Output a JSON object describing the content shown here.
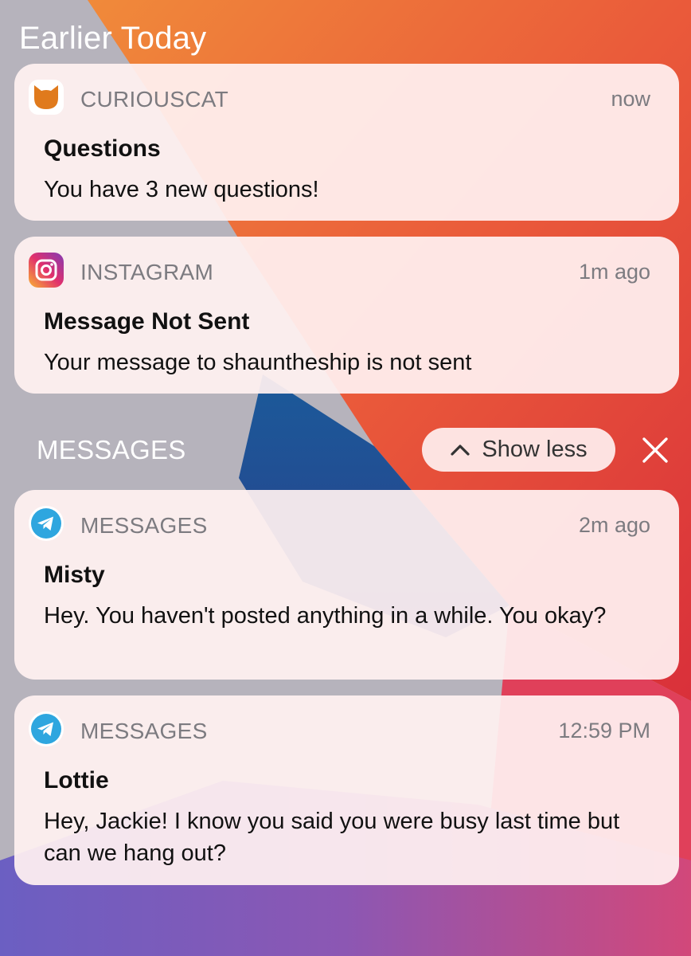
{
  "section_title": "Earlier Today",
  "notifications": [
    {
      "app": "CURIOUSCAT",
      "icon": "curiouscat-icon",
      "time": "now",
      "title": "Questions",
      "body": "You have 3 new questions!"
    },
    {
      "app": "INSTAGRAM",
      "icon": "instagram-icon",
      "time": "1m ago",
      "title": "Message Not Sent",
      "body": "Your message to shauntheship is not sent"
    }
  ],
  "group": {
    "name": "MESSAGES",
    "show_less_label": "Show less",
    "notifications": [
      {
        "app": "MESSAGES",
        "icon": "telegram-icon",
        "time": "2m ago",
        "title": "Misty",
        "body": "Hey. You haven't posted anything in a while. You okay?"
      },
      {
        "app": "MESSAGES",
        "icon": "telegram-icon",
        "time": "12:59 PM",
        "title": "Lottie",
        "body": "Hey, Jackie! I know you said you were busy last time but can we hang out?"
      }
    ]
  },
  "colors": {
    "card_bg": "#fff1f1",
    "curiouscat": "#e07a1c",
    "telegram": "#2ea6df"
  }
}
